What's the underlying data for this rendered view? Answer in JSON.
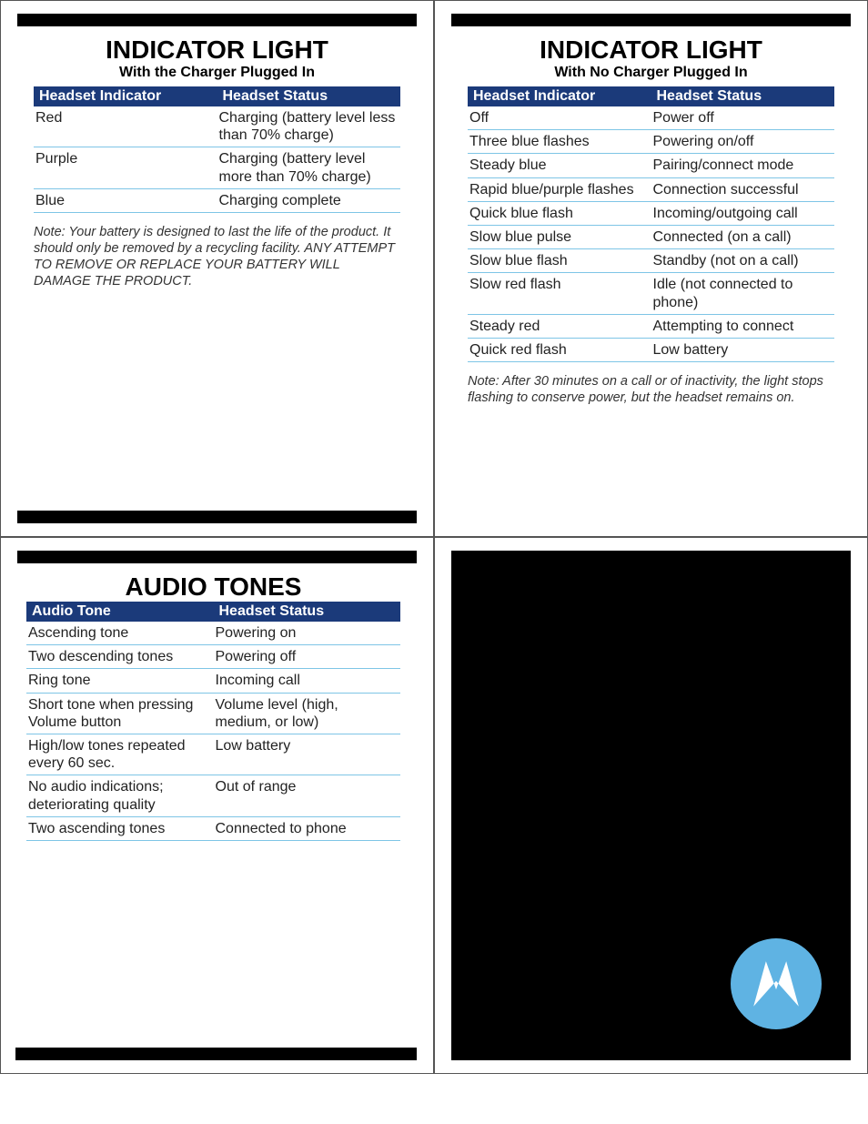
{
  "panel1": {
    "title": "INDICATOR LIGHT",
    "subtitle": "With the Charger Plugged In",
    "col1": "Headset Indicator",
    "col2": "Headset Status",
    "rows": [
      {
        "a": "Red",
        "b": "Charging (battery level less than 70% charge)"
      },
      {
        "a": "Purple",
        "b": "Charging (battery level more than 70% charge)"
      },
      {
        "a": "Blue",
        "b": "Charging complete"
      }
    ],
    "note": "Note: Your battery is designed to last the life of the product. It should only be removed by a recycling facility. ANY ATTEMPT TO REMOVE OR REPLACE YOUR BATTERY WILL DAMAGE THE PRODUCT."
  },
  "panel2": {
    "title": "INDICATOR LIGHT",
    "subtitle": "With No Charger Plugged In",
    "col1": "Headset Indicator",
    "col2": "Headset Status",
    "rows": [
      {
        "a": "Off",
        "b": "Power off"
      },
      {
        "a": "Three blue flashes",
        "b": "Powering on/off"
      },
      {
        "a": "Steady blue",
        "b": "Pairing/connect mode"
      },
      {
        "a": "Rapid blue/purple flashes",
        "b": "Connection successful"
      },
      {
        "a": "Quick blue flash",
        "b": "Incoming/outgoing call"
      },
      {
        "a": "Slow blue pulse",
        "b": "Connected (on a call)"
      },
      {
        "a": "Slow blue flash",
        "b": "Standby (not on a call)"
      },
      {
        "a": "Slow red flash",
        "b": "Idle (not connected to phone)"
      },
      {
        "a": "Steady red",
        "b": "Attempting to connect"
      },
      {
        "a": "Quick red flash",
        "b": "Low battery"
      }
    ],
    "note": "Note: After 30 minutes on a call or of inactivity, the light stops flashing to conserve power, but the headset remains on."
  },
  "panel3": {
    "title": "AUDIO TONES",
    "col1": "Audio Tone",
    "col2": "Headset Status",
    "rows": [
      {
        "a": "Ascending tone",
        "b": "Powering on"
      },
      {
        "a": "Two descending tones",
        "b": "Powering off"
      },
      {
        "a": "Ring tone",
        "b": "Incoming call"
      },
      {
        "a": "Short tone when pressing Volume button",
        "b": "Volume level (high, medium, or low)"
      },
      {
        "a": "High/low tones repeated every 60 sec.",
        "b": "Low battery"
      },
      {
        "a": "No audio indications; deteriorating quality",
        "b": "Out of range"
      },
      {
        "a": "Two ascending tones",
        "b": "Connected to phone"
      }
    ]
  },
  "panel4": {
    "logo_name": "motorola-logo"
  }
}
